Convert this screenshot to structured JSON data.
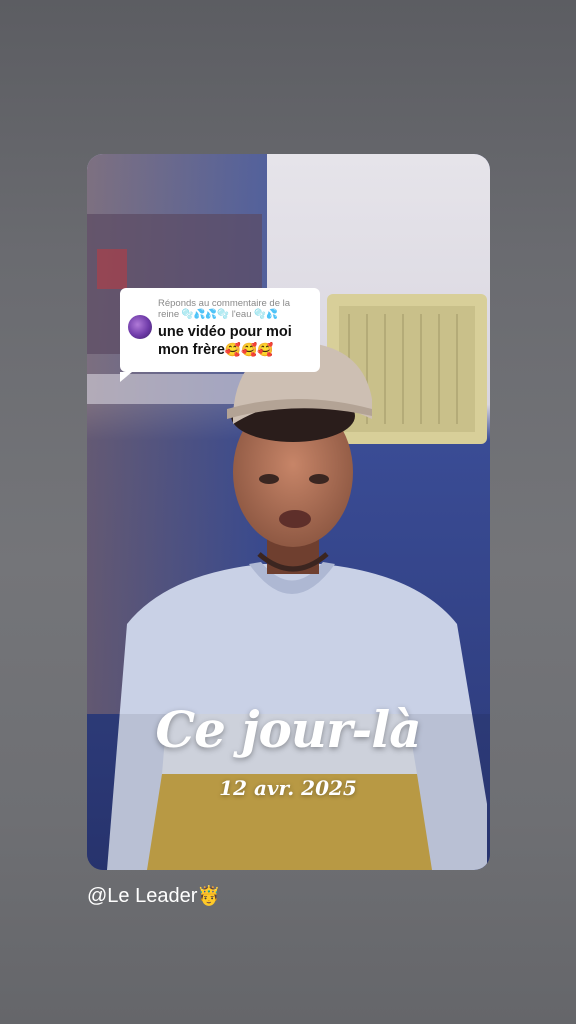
{
  "reply": {
    "header_line1": "Réponds au commentaire de la",
    "header_line2": "reine 🫧💦💦🫧 l'eau 🫧💦",
    "text_line1": "une vidéo pour moi",
    "text_line2": "mon frère",
    "text_emojis": "🥰🥰🥰"
  },
  "memory": {
    "title": "Ce jour-là",
    "date": "12 avr. 2025"
  },
  "author": {
    "handle": "@Le Leader",
    "badge": "🤴"
  },
  "colors": {
    "background": "#6a6b70",
    "wall": "#2e3f86",
    "shirt": "#c9d1e6",
    "shirt_accent": "#c8a74a"
  }
}
